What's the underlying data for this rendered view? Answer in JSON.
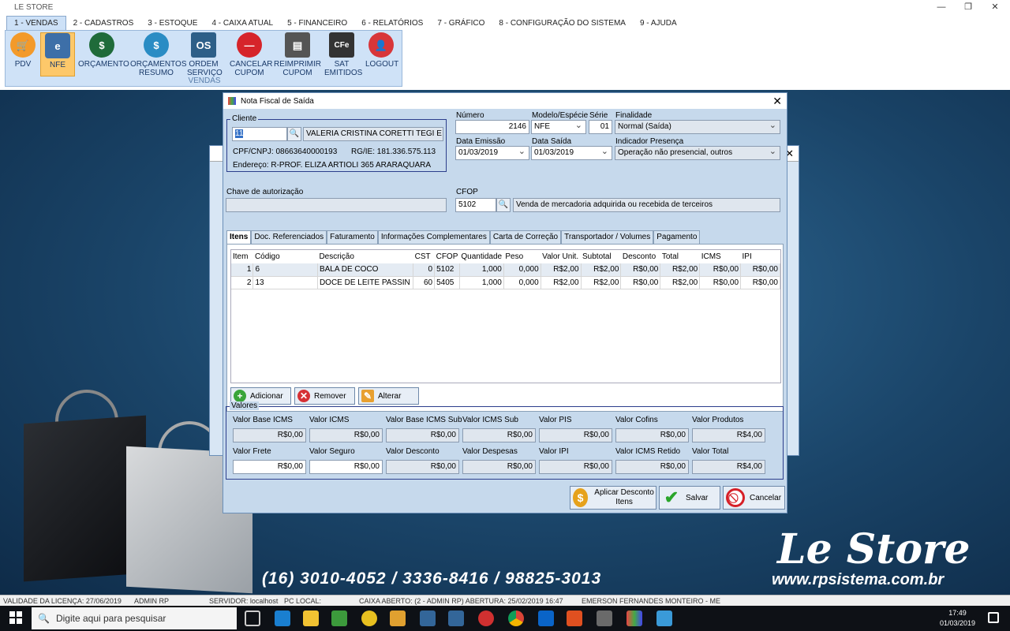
{
  "window": {
    "title": "LE STORE",
    "minimize": "—",
    "maximize": "❐",
    "close": "✕"
  },
  "menu_tabs": [
    "1 - VENDAS",
    "2 - CADASTROS",
    "3 - ESTOQUE",
    "4 - CAIXA ATUAL",
    "5 - FINANCEIRO",
    "6 - RELATÓRIOS",
    "7 - GRÁFICO",
    "8 - CONFIGURAÇÃO DO SISTEMA",
    "9 - AJUDA"
  ],
  "ribbon": {
    "group_label": "VENDAS",
    "buttons": [
      {
        "label": "PDV",
        "icon": "cart-icon"
      },
      {
        "label": "NFE",
        "icon": "nfe-icon"
      },
      {
        "label": "ORÇAMENTO",
        "icon": "money-icon"
      },
      {
        "label": "ORÇAMENTOS RESUMO",
        "icon": "dollar-icon"
      },
      {
        "label": "ORDEM SERVIÇO",
        "icon": "order-icon"
      },
      {
        "label": "CANCELAR CUPOM",
        "icon": "cancel-icon"
      },
      {
        "label": "REIMPRIMIR CUPOM",
        "icon": "printer-icon"
      },
      {
        "label": "SAT EMITIDOS",
        "icon": "sat-icon"
      },
      {
        "label": "LOGOUT",
        "icon": "user-icon"
      }
    ]
  },
  "background": {
    "brand": "Le Store",
    "site": "www.rpsistema.com.br",
    "phones": "(16) 3010-4052 / 3336-8416 / 98825-3013"
  },
  "dialog": {
    "title": "Nota Fiscal de Saída",
    "close": "✕",
    "cliente": {
      "group_label": "Cliente",
      "code": "11",
      "name": "VALERIA CRISTINA CORETTI TEGI E CIA",
      "cpf_cnpj": "CPF/CNPJ: 08663640000193",
      "rg_ie": "RG/IE:  181.336.575.113",
      "endereco": "Endereço:  R-PROF. ELIZA ARTIOLI 365 ARARAQUARA"
    },
    "numero": {
      "label": "Número",
      "value": "2146"
    },
    "modelo": {
      "label": "Modelo/Espécie",
      "value": "NFE"
    },
    "serie": {
      "label": "Série",
      "value": "01"
    },
    "finalidade": {
      "label": "Finalidade",
      "value": "Normal (Saída)"
    },
    "data_emissao": {
      "label": "Data Emissão",
      "value": "01/03/2019"
    },
    "data_saida": {
      "label": "Data Saída",
      "value": "01/03/2019"
    },
    "indicador": {
      "label": "Indicador Presença",
      "value": "Operação não presencial, outros"
    },
    "chave": {
      "label": "Chave de autorização",
      "value": ""
    },
    "cfop": {
      "label": "CFOP",
      "code": "5102",
      "desc": "Venda de mercadoria adquirida ou recebida de terceiros"
    },
    "tabs": [
      "Itens",
      "Doc. Referenciados",
      "Faturamento",
      "Informações Complementares",
      "Carta de Correção",
      "Transportador / Volumes",
      "Pagamento"
    ],
    "grid": {
      "columns": [
        "Item",
        "Código",
        "Descrição",
        "CST",
        "CFOP",
        "Quantidade",
        "Peso",
        "Valor Unit.",
        "Subtotal",
        "Desconto",
        "Total",
        "ICMS",
        "IPI"
      ],
      "rows": [
        [
          "1",
          "6",
          "BALA DE COCO",
          "0",
          "5102",
          "1,000",
          "0,000",
          "R$2,00",
          "R$2,00",
          "R$0,00",
          "R$2,00",
          "R$0,00",
          "R$0,00"
        ],
        [
          "2",
          "13",
          "DOCE DE LEITE PASSIN",
          "60",
          "5405",
          "1,000",
          "0,000",
          "R$2,00",
          "R$2,00",
          "R$0,00",
          "R$2,00",
          "R$0,00",
          "R$0,00"
        ]
      ]
    },
    "grid_buttons": {
      "add": "Adicionar",
      "remove": "Remover",
      "edit": "Alterar"
    },
    "valores": {
      "group_label": "Valores",
      "row1": [
        {
          "label": "Valor Base ICMS",
          "value": "R$0,00"
        },
        {
          "label": "Valor ICMS",
          "value": "R$0,00"
        },
        {
          "label": "Valor Base ICMS Sub",
          "value": "R$0,00"
        },
        {
          "label": "Valor ICMS Sub",
          "value": "R$0,00"
        },
        {
          "label": "Valor PIS",
          "value": "R$0,00"
        },
        {
          "label": "Valor Cofins",
          "value": "R$0,00"
        },
        {
          "label": "Valor Produtos",
          "value": "R$4,00"
        }
      ],
      "row2": [
        {
          "label": "Valor Frete",
          "value": "R$0,00"
        },
        {
          "label": "Valor Seguro",
          "value": "R$0,00"
        },
        {
          "label": "Valor Desconto",
          "value": "R$0,00"
        },
        {
          "label": "Valor Despesas",
          "value": "R$0,00"
        },
        {
          "label": "Valor IPI",
          "value": "R$0,00"
        },
        {
          "label": "Valor ICMS Retido",
          "value": "R$0,00"
        },
        {
          "label": "Valor Total",
          "value": "R$4,00"
        }
      ]
    },
    "footer_buttons": {
      "desconto": "Aplicar Desconto Itens",
      "salvar": "Salvar",
      "cancelar": "Cancelar"
    }
  },
  "statusbar": {
    "licenca": "VALIDADE DA LICENÇA: 27/06/2019",
    "user": "ADMIN RP",
    "servidor": "SERVIDOR: localhost",
    "pc": "PC LOCAL:",
    "caixa": "CAIXA ABERTO: (2 - ADMIN RP) ABERTURA: 25/02/2019 16:47",
    "empresa": "EMERSON FERNANDES MONTEIRO - ME"
  },
  "taskbar": {
    "search_placeholder": "Digite aqui para pesquisar",
    "time": "17:49",
    "date": "01/03/2019"
  },
  "colors": {
    "accent": "#cfe2f7",
    "dialog_bg": "#c6d9ec",
    "desktop": "#1d4a6e"
  }
}
